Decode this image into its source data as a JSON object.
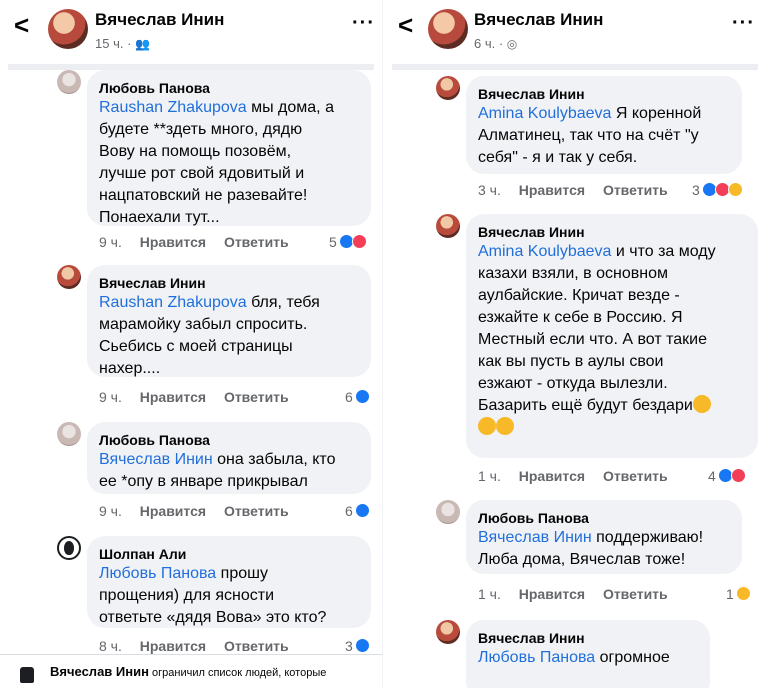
{
  "left": {
    "header": {
      "back": "<",
      "name": "Вячеслав Инин",
      "time": "15 ч. ·",
      "audience_icon": "friends-icon",
      "more": "···"
    },
    "comments": [
      {
        "author": "Любовь Панова",
        "mention": "Raushan Zhakupova",
        "text_lines": [
          " мы дома, а",
          "будете **здеть много, дядю",
          "Вову на помощь позовём,",
          "лучше рот свой ядовитый и",
          "нацпатовский не разевайте!",
          "Понаехали тут..."
        ],
        "time": "9 ч.",
        "like": "Нравится",
        "reply": "Ответить",
        "count": "5"
      },
      {
        "author": "Вячеслав Инин",
        "mention": "Raushan Zhakupova",
        "text_lines": [
          " бля, тебя",
          "марамойку забыл спросить.",
          "Сьебись с моей страницы",
          "нахер...."
        ],
        "time": "9 ч.",
        "like": "Нравится",
        "reply": "Ответить",
        "count": "6"
      },
      {
        "author": "Любовь Панова",
        "mention": "Вячеслав Инин",
        "text_lines": [
          " она забыла, кто",
          "ее *опу в январе прикрывал"
        ],
        "time": "9 ч.",
        "like": "Нравится",
        "reply": "Ответить",
        "count": "6"
      },
      {
        "author": "Шолпан Али",
        "mention": "Любовь Панова",
        "text_lines": [
          " прошу",
          "прощения) для ясности",
          "ответьте «дядя Вова» это кто?"
        ],
        "time": "8 ч.",
        "like": "Нравится",
        "reply": "Ответить",
        "count": "3"
      }
    ],
    "footer": {
      "name": "Вячеслав Инин",
      "text": " ограничил список людей, которые"
    }
  },
  "right": {
    "header": {
      "back": "<",
      "name": "Вячеслав Инин",
      "time": "6 ч. ·",
      "audience_icon": "globe-icon",
      "more": "···"
    },
    "comments": [
      {
        "author": "Вячеслав Инин",
        "mention": "Amina Koulybaeva",
        "text_lines": [
          " Я коренной",
          "Алматинец, так что на счёт \"у",
          "себя\" - я и так у себя."
        ],
        "time": "3 ч.",
        "like": "Нравится",
        "reply": "Ответить",
        "count": "3"
      },
      {
        "author": "Вячеслав Инин",
        "mention": "Amina Koulybaeva",
        "text_lines": [
          " и что за моду",
          "казахи взяли, в основном",
          "аулбайские. Кричат везде -",
          "езжайте к себе в Россию. Я",
          "Местный если что. А вот такие",
          "как вы пусть в аулы свои",
          "езжают - откуда вылезли.",
          "Базарить ещё будут бездари"
        ],
        "time": "1 ч.",
        "like": "Нравится",
        "reply": "Ответить",
        "count": "4"
      },
      {
        "author": "Любовь Панова",
        "mention": "Вячеслав Инин",
        "text_lines": [
          " поддерживаю!",
          "Люба дома, Вячеслав тоже!"
        ],
        "time": "1 ч.",
        "like": "Нравится",
        "reply": "Ответить",
        "count": "1"
      },
      {
        "author": "Вячеслав Инин",
        "mention": "Любовь Панова",
        "text_lines": [
          " огромное"
        ],
        "time": "",
        "like": "",
        "reply": "",
        "count": ""
      }
    ]
  },
  "colors": {
    "mention": "#216fdb",
    "bubble": "#f0f2f5",
    "meta": "#65676b",
    "like": "#1877f2",
    "love": "#f33e58",
    "haha": "#f7b928"
  }
}
